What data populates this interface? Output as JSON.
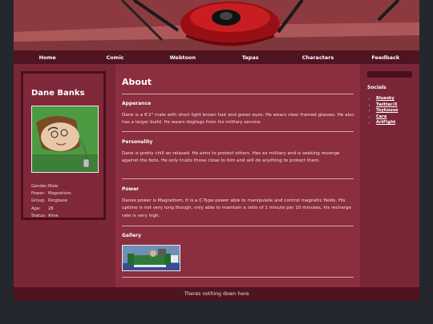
{
  "nav": {
    "items": [
      "Home",
      "Comic",
      "Webtoon",
      "Tapas",
      "Characters",
      "Feedback"
    ]
  },
  "profile": {
    "name": "Dane Banks",
    "stats": [
      {
        "label": "Gender:",
        "value": "Male"
      },
      {
        "label": "Power:",
        "value": "Magnetism"
      },
      {
        "label": "Group:",
        "value": "Ringbase"
      },
      {
        "label": "Age:",
        "value": "28"
      },
      {
        "label": "Status:",
        "value": "Alive"
      }
    ]
  },
  "main": {
    "title": "About",
    "appearance": {
      "heading": "Apperance",
      "text": "Dane is a 6'2\" male with short light brown hair and green eyes. He wears clear framed glasses. He also has a larger build. He wears dogtags from his military service."
    },
    "personality": {
      "heading": "Personality",
      "text": "Dane is pretty chill an relaxed. He aims to protect others. Hes ex military and is seeking revenge against the bots. He only trusts those close to him and will do anything to protect them."
    },
    "power": {
      "heading": "Power",
      "text": "Danes power is Magnetism, It is a C-Type power able to manipulate and control magnetic fields. His uptime is not very long though, only able to maintain a ratio of 1 minute per 10 minutes, his recharge rate is very high."
    },
    "gallery": {
      "heading": "Gallery"
    }
  },
  "sidebar": {
    "heading": "Socials",
    "links": [
      "Bluesky",
      "Twitter/X",
      "Toyhouse",
      "Cara",
      "ArtFight"
    ]
  },
  "footer": {
    "text": "Theres nothing down here"
  },
  "colors": {
    "nav_bg": "#4f1420",
    "content_bg": "#8b2e3d",
    "side_bg": "#7a2637",
    "card_border": "#4a0f1c"
  }
}
